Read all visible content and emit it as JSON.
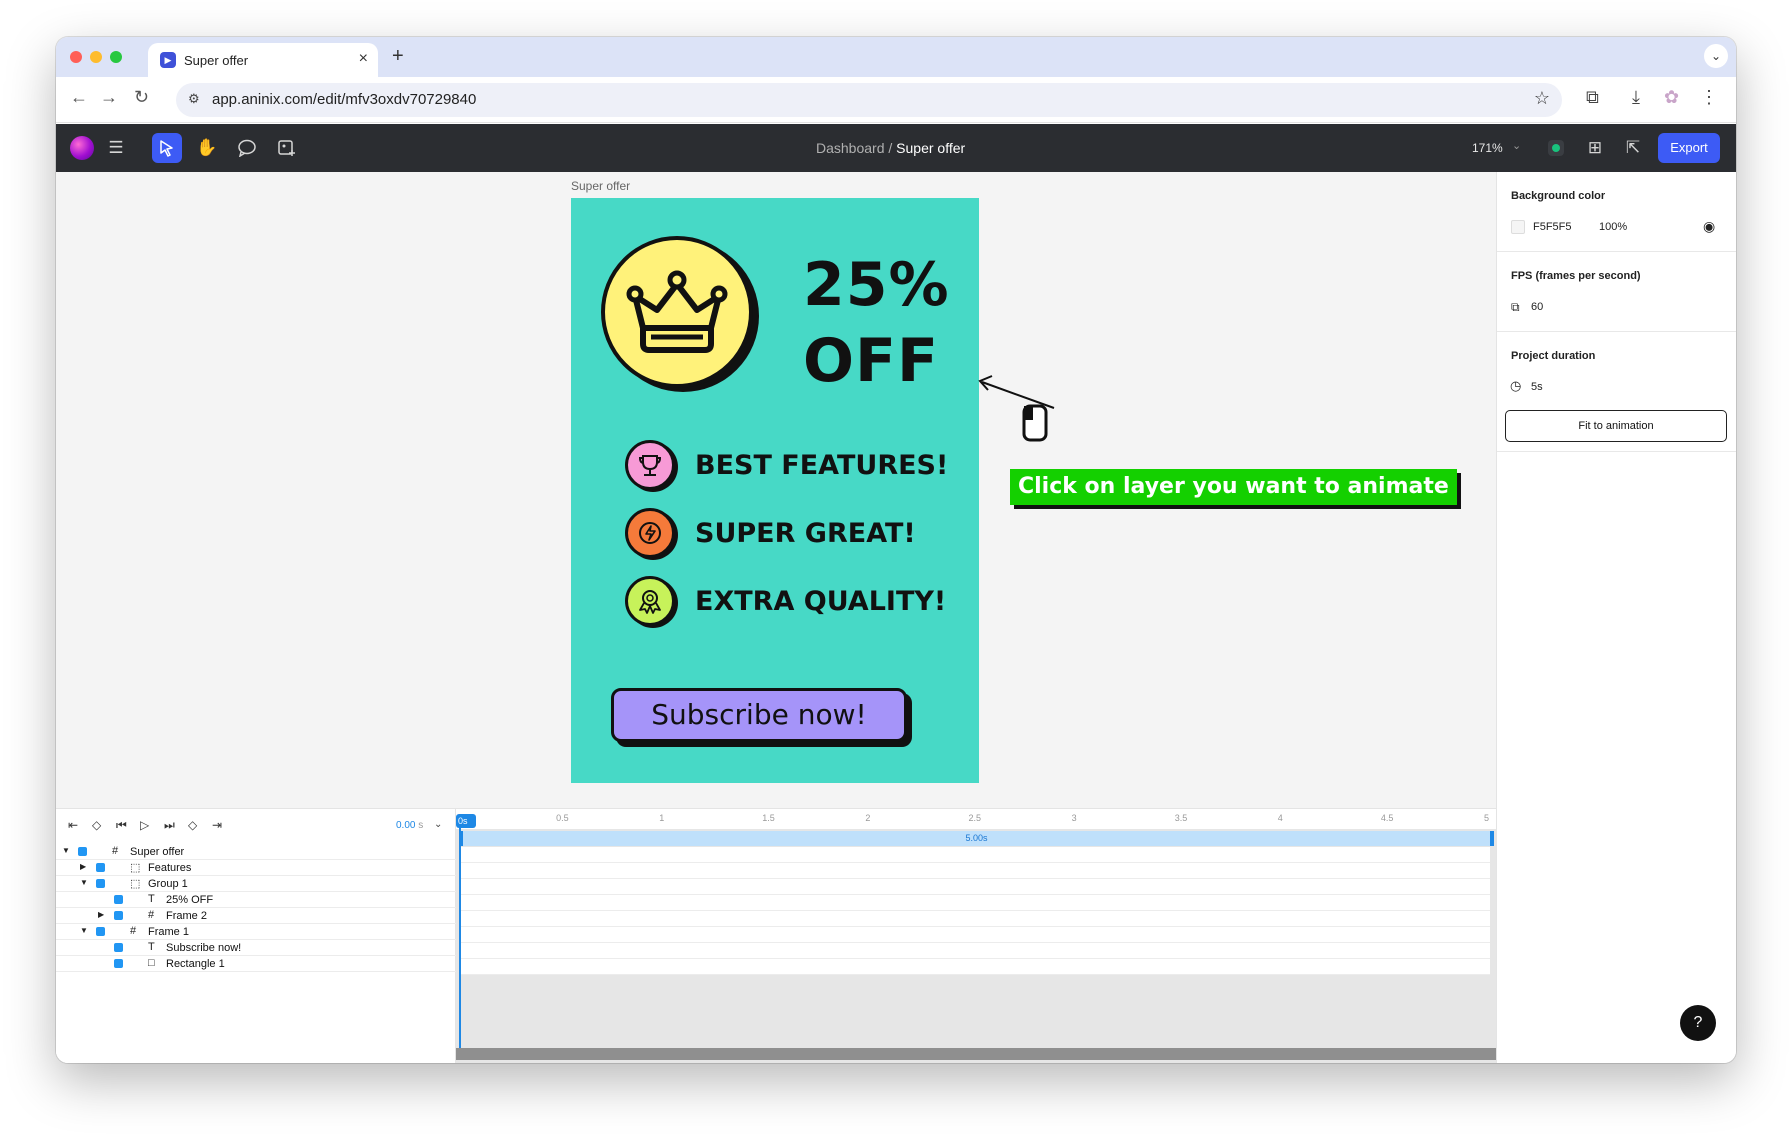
{
  "browser": {
    "tab_title": "Super offer",
    "new_tab": "+",
    "url": "app.aninix.com/edit/mfv3oxdv70729840"
  },
  "app": {
    "breadcrumb_parent": "Dashboard",
    "breadcrumb_sep": " / ",
    "breadcrumb_current": "Super offer",
    "zoom": "171%",
    "export_label": "Export"
  },
  "canvas": {
    "frame_label": "Super offer",
    "offer_line1": "25%",
    "offer_line2": "OFF",
    "features": [
      {
        "label": "BEST FEATURES!",
        "color": "#f79ad6",
        "icon": "trophy-icon"
      },
      {
        "label": "SUPER GREAT!",
        "color": "#f57a3a",
        "icon": "lightning-icon"
      },
      {
        "label": "EXTRA QUALITY!",
        "color": "#c7f25a",
        "icon": "award-icon"
      }
    ],
    "cta_label": "Subscribe now!",
    "hint": "Click on layer you want to animate",
    "bg_color": "#47d9c6",
    "coin_color": "#fff27a",
    "cta_color": "#a594f9",
    "hint_color": "#14d000"
  },
  "panel": {
    "bg_title": "Background color",
    "bg_hex": "F5F5F5",
    "bg_opacity": "100%",
    "fps_title": "FPS (frames per second)",
    "fps_value": "60",
    "duration_title": "Project duration",
    "duration_value": "5s",
    "fit_label": "Fit to animation",
    "help": "?"
  },
  "timeline": {
    "time_value": "0.00",
    "time_unit": " s",
    "zero_label": "0s",
    "ticks": [
      "0.5",
      "1",
      "1.5",
      "2",
      "2.5",
      "3",
      "3.5",
      "4",
      "4.5",
      "5"
    ],
    "duration_label": "5.00s",
    "layers": [
      {
        "name": "Super offer",
        "type": "frame",
        "twisty": "open",
        "depth": 0
      },
      {
        "name": "Features",
        "type": "group",
        "twisty": "closed",
        "depth": 1
      },
      {
        "name": "Group 1",
        "type": "group",
        "twisty": "open",
        "depth": 1
      },
      {
        "name": "25% OFF",
        "type": "text",
        "twisty": "none",
        "depth": 2
      },
      {
        "name": "Frame 2",
        "type": "frame",
        "twisty": "closed",
        "depth": 2
      },
      {
        "name": "Frame 1",
        "type": "frame",
        "twisty": "open",
        "depth": 1
      },
      {
        "name": "Subscribe now!",
        "type": "text",
        "twisty": "none",
        "depth": 2
      },
      {
        "name": "Rectangle 1",
        "type": "rect",
        "twisty": "none",
        "depth": 2
      }
    ]
  }
}
